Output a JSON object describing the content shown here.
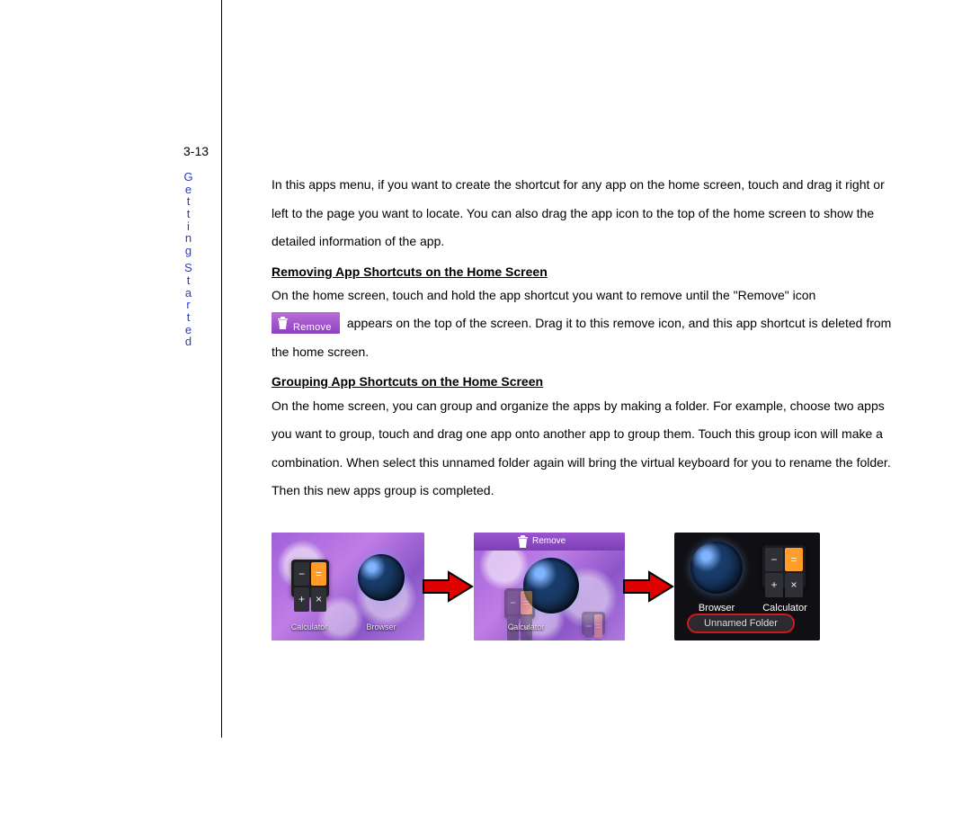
{
  "page_number": "3-13",
  "section_label": "Getting Started",
  "intro_para": "In this apps menu, if you want to create the shortcut for any app on the home screen, touch and drag it right or left to the page you want to locate. You can also drag the app icon to the top of the home screen to show the detailed information of the app.",
  "h1": "Removing App Shortcuts on the Home Screen",
  "remove_p1": "On the home screen, touch and hold the app shortcut you want to remove until the \"Remove\" icon",
  "remove_chip_label": "Remove",
  "remove_p2": "appears on the top of the screen. Drag it to this remove icon, and this app shortcut is deleted from the home screen.",
  "h2": "Grouping App Shortcuts on the Home Screen",
  "group_para": "On the home screen, you can group and organize the apps by making a folder. For example, choose two apps you want to group, touch and drag one app onto another app to group them. Touch this group icon will make a combination. When select this unnamed folder again will bring the virtual keyboard for you to rename the folder. Then this new apps group is completed.",
  "figures": {
    "panel1": {
      "icon1_label": "Calculator",
      "icon2_label": "Browser"
    },
    "panel2": {
      "removebar_label": "Remove",
      "icon1_label": "Calculator"
    },
    "panel3": {
      "icon1_label": "Browser",
      "icon2_label": "Calculator",
      "folder_label": "Unnamed Folder"
    }
  }
}
